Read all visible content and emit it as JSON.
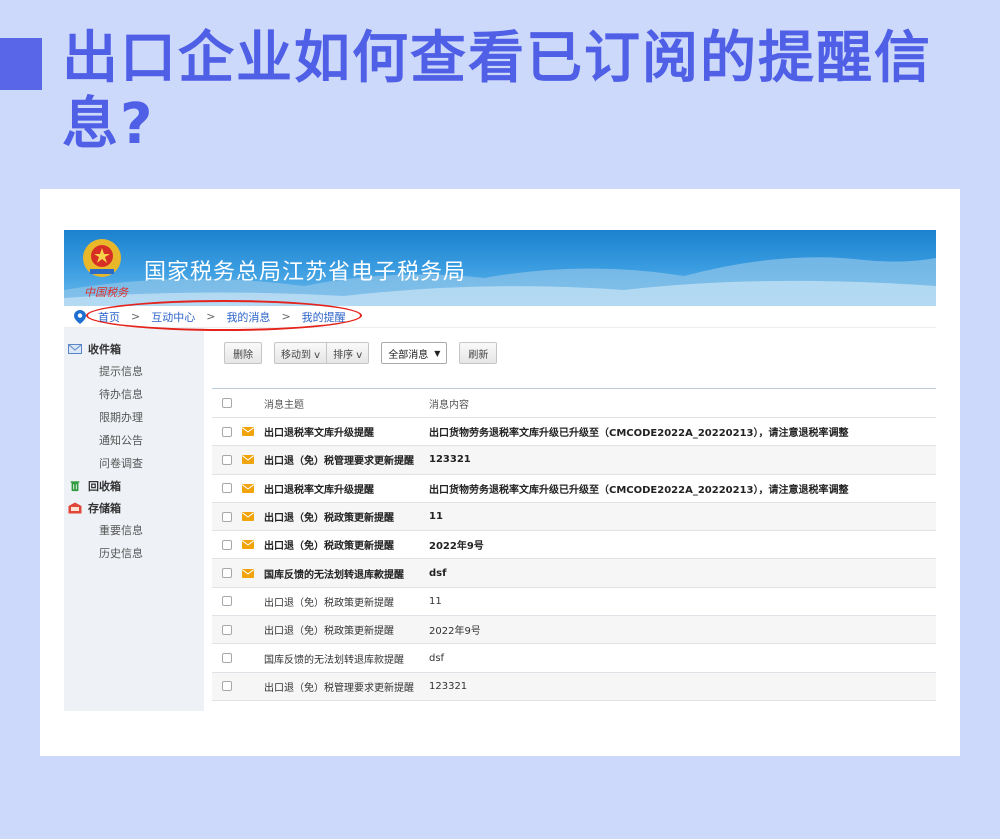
{
  "headline": "出口企业如何查看已订阅的提醒信息?",
  "colors": {
    "accent": "#5a66e8",
    "background": "#cdd9fb",
    "highlight": "#e3231c",
    "envelope": "#f0a30a"
  },
  "banner": {
    "title": "国家税务总局江苏省电子税务局",
    "emblem_text": "中国税务",
    "icon": "tax-emblem-icon"
  },
  "breadcrumb": {
    "items": [
      "首页",
      "互动中心",
      "我的消息",
      "我的提醒"
    ],
    "separator": ">"
  },
  "sidebar": {
    "inbox": {
      "label": "收件箱",
      "icon": "mail-icon",
      "items": [
        "提示信息",
        "待办信息",
        "限期办理",
        "通知公告",
        "问卷调查"
      ]
    },
    "recycle": {
      "label": "回收箱",
      "icon": "trash-icon"
    },
    "storage": {
      "label": "存储箱",
      "icon": "storage-box-icon",
      "items": [
        "重要信息",
        "历史信息"
      ]
    }
  },
  "toolbar": {
    "delete": "删除",
    "move_to": "移动到 v",
    "sort": "排序 v",
    "filter_selected": "全部消息",
    "refresh": "刷新"
  },
  "table": {
    "columns": [
      "消息主题",
      "消息内容"
    ],
    "rows": [
      {
        "subject": "出口退税率文库升级提醒",
        "content": "出口货物劳务退税率文库升级已升级至（CMCODE2022A_20220213），请注意退税率调整",
        "unread": true
      },
      {
        "subject": "出口退（免）税管理要求更新提醒",
        "content": "123321",
        "unread": true
      },
      {
        "subject": "出口退税率文库升级提醒",
        "content": "出口货物劳务退税率文库升级已升级至（CMCODE2022A_20220213），请注意退税率调整",
        "unread": true
      },
      {
        "subject": "出口退（免）税政策更新提醒",
        "content": "11",
        "unread": true
      },
      {
        "subject": "出口退（免）税政策更新提醒",
        "content": "2022年9号",
        "unread": true
      },
      {
        "subject": "国库反馈的无法划转退库款提醒",
        "content": "dsf",
        "unread": true
      },
      {
        "subject": "出口退（免）税政策更新提醒",
        "content": "11",
        "unread": false
      },
      {
        "subject": "出口退（免）税政策更新提醒",
        "content": "2022年9号",
        "unread": false
      },
      {
        "subject": "国库反馈的无法划转退库款提醒",
        "content": "dsf",
        "unread": false
      },
      {
        "subject": "出口退（免）税管理要求更新提醒",
        "content": "123321",
        "unread": false
      }
    ]
  }
}
